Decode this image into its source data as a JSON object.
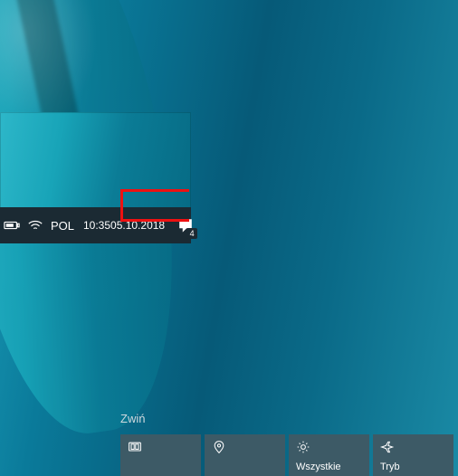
{
  "tray": {
    "language": "POL",
    "time": "10:35",
    "date": "05.10.2018",
    "notification_count": "4"
  },
  "action_center": {
    "collapse_label": "Zwiń",
    "tiles": [
      {
        "id": "tablet",
        "label": ""
      },
      {
        "id": "location",
        "label": ""
      },
      {
        "id": "settings",
        "label": "Wszystkie"
      },
      {
        "id": "airplane",
        "label": "Tryb"
      }
    ]
  }
}
